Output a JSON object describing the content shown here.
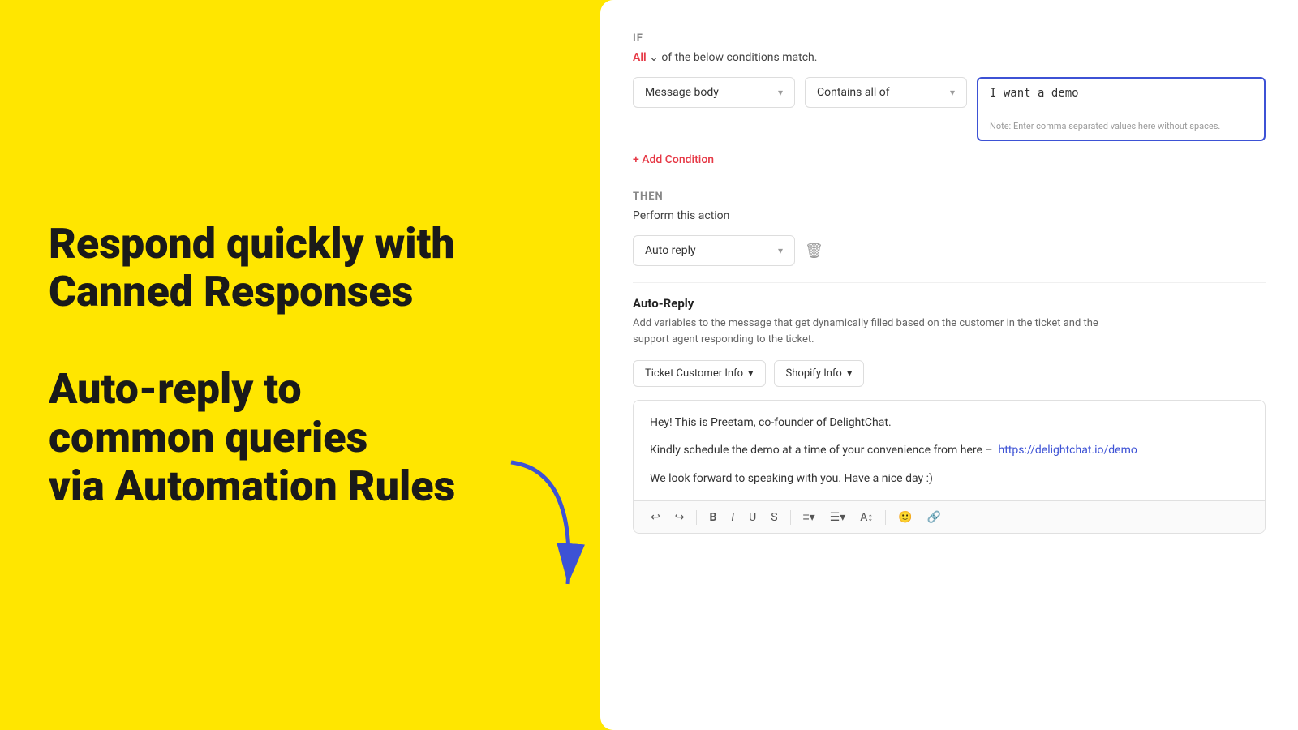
{
  "left": {
    "headline": "Respond quickly with\nCanned Responses",
    "subheadline": "Auto-reply to\ncommon queries\nvia Automation Rules"
  },
  "panel": {
    "if_label": "IF",
    "all_text": "All",
    "conditions_suffix": "of the below conditions match.",
    "message_body_label": "Message body",
    "contains_all_of_label": "Contains all of",
    "input_value": "I want a demo",
    "input_note": "Note: Enter comma separated values here without spaces.",
    "add_condition": "+ Add Condition",
    "then_label": "THEN",
    "perform_action": "Perform this action",
    "auto_reply_label": "Auto reply",
    "auto_reply_title": "Auto-Reply",
    "auto_reply_desc": "Add variables to the message that get dynamically filled based on the customer in the ticket and the support agent responding to the ticket.",
    "ticket_customer_info": "Ticket Customer Info",
    "shopify_info": "Shopify Info",
    "message_line1": "Hey! This is Preetam, co-founder of DelightChat.",
    "message_line2": "Kindly schedule the demo at a time of your convenience from here –",
    "message_link": "https://delightchat.io/demo",
    "message_line3": "We look forward to speaking with you. Have a nice day :)"
  }
}
